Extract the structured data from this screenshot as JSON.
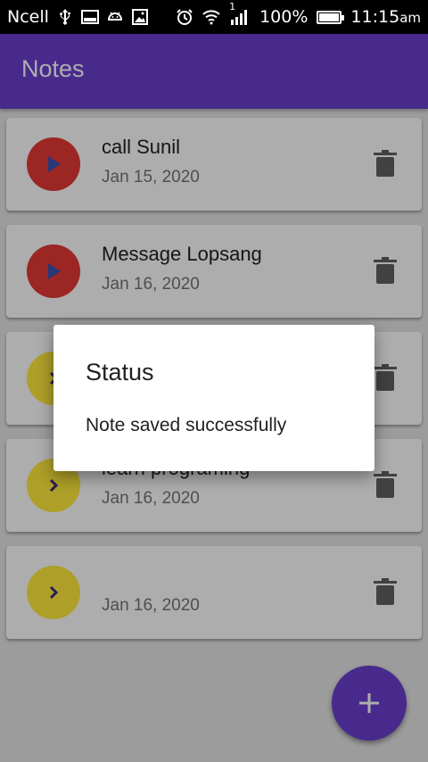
{
  "status_bar": {
    "carrier": "Ncell",
    "signal_sim": "1",
    "battery_percent": "100%",
    "battery_level": 1.0,
    "time": "11:15",
    "time_suffix": "am"
  },
  "app_bar": {
    "title": "Notes"
  },
  "notes": [
    {
      "title": "call Sunil",
      "date": "Jan 15, 2020",
      "avatar_color": "#e53935",
      "avatar_icon": "play-icon"
    },
    {
      "title": "Message Lopsang",
      "date": "Jan 16, 2020",
      "avatar_color": "#e53935",
      "avatar_icon": "play-icon"
    },
    {
      "title": "",
      "date": "",
      "avatar_color": "#ffeb3b",
      "avatar_icon": "chevron-right-icon"
    },
    {
      "title": "learn programing",
      "date": "Jan 16, 2020",
      "avatar_color": "#ffeb3b",
      "avatar_icon": "chevron-right-icon"
    },
    {
      "title": "",
      "date": "Jan 16, 2020",
      "avatar_color": "#ffeb3b",
      "avatar_icon": "chevron-right-icon"
    }
  ],
  "fab": {
    "icon": "plus-icon"
  },
  "dialog": {
    "title": "Status",
    "message": "Note saved successfully"
  },
  "colors": {
    "primary": "#6a3fd0",
    "red_avatar": "#e53935",
    "yellow_avatar": "#ffeb3b"
  }
}
